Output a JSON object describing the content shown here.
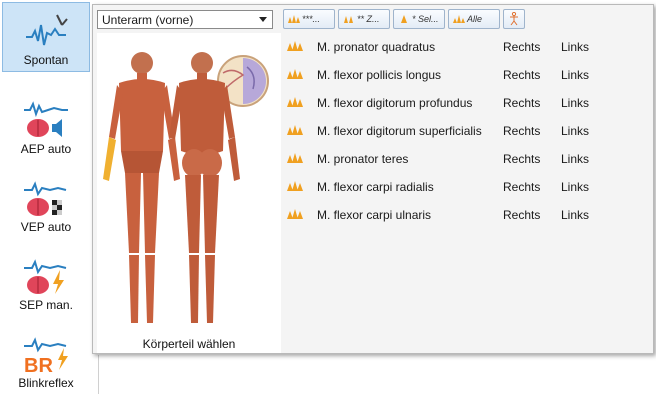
{
  "sidebar": {
    "items": [
      {
        "label": "Spontan",
        "icon": "spontan-wave-icon",
        "active": true
      },
      {
        "label": "AEP auto",
        "icon": "aep-brain-speaker-icon",
        "active": false
      },
      {
        "label": "VEP auto",
        "icon": "vep-brain-checker-icon",
        "active": false
      },
      {
        "label": "SEP man.",
        "icon": "sep-brain-lightning-icon",
        "active": false
      },
      {
        "label": "Blinkreflex",
        "icon": "br-lightning-icon",
        "active": false
      }
    ]
  },
  "popup": {
    "region_select": {
      "value": "Unterarm (vorne)"
    },
    "toolbar": [
      {
        "label": "***...",
        "icon": "three-star-icon"
      },
      {
        "label": "** Z...",
        "icon": "two-star-icon"
      },
      {
        "label": "* Sel...",
        "icon": "one-star-icon"
      },
      {
        "label": "Alle",
        "icon": "all-icon"
      },
      {
        "label": "",
        "icon": "body-figure-icon"
      }
    ],
    "body_panel_label": "Körperteil wählen",
    "muscles": [
      {
        "name": "M. pronator quadratus",
        "rechts": "Rechts",
        "links": "Links"
      },
      {
        "name": "M. flexor pollicis longus",
        "rechts": "Rechts",
        "links": "Links"
      },
      {
        "name": "M. flexor digitorum profundus",
        "rechts": "Rechts",
        "links": "Links"
      },
      {
        "name": "M. flexor digitorum superficialis",
        "rechts": "Rechts",
        "links": "Links"
      },
      {
        "name": "M. pronator teres",
        "rechts": "Rechts",
        "links": "Links"
      },
      {
        "name": "M. flexor carpi radialis",
        "rechts": "Rechts",
        "links": "Links"
      },
      {
        "name": "M. flexor carpi ulnaris",
        "rechts": "Rechts",
        "links": "Links"
      }
    ]
  },
  "colors": {
    "accent": "#cde4f7",
    "wave": "#2a7fc0",
    "brain": "#e0455a",
    "star": "#f0a020"
  }
}
